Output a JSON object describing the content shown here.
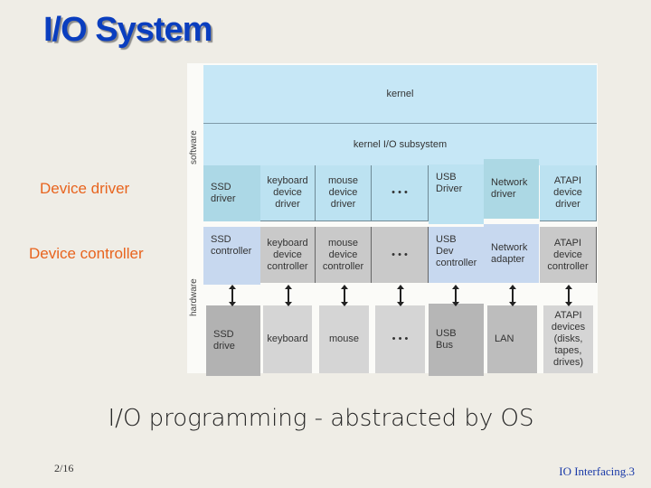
{
  "title": "I/O System",
  "side_labels": {
    "driver": "Device driver",
    "controller": "Device controller"
  },
  "diagram": {
    "software_label": "software",
    "hardware_label": "hardware",
    "kernel": "kernel",
    "kernel_io": "kernel I/O subsystem",
    "drivers": [
      "SSD\ndriver",
      "keyboard\ndevice\ndriver",
      "mouse\ndevice\ndriver",
      "• • •",
      "USB\nDriver",
      "Network\ndriver",
      "ATAPI\ndevice\ndriver"
    ],
    "controllers": [
      "SSD\ncontroller",
      "keyboard\ndevice\ncontroller",
      "mouse\ndevice\ncontroller",
      "• • •",
      "USB\nDev\ncontroller",
      "Network\nadapter",
      "ATAPI\ndevice\ncontroller"
    ],
    "devices": [
      "SSD\ndrive",
      "keyboard",
      "mouse",
      "• • •",
      "USB\nBus",
      "LAN",
      "ATAPI\ndevices\n(disks,\ntapes,\ndrives)"
    ],
    "colors": {
      "kernel": "#c6e7f6",
      "driver": "#bce2f1",
      "controller": "#c9c9c9",
      "added_controller": "#c7d8ef",
      "device": "#d5d5d5"
    }
  },
  "caption": "I/O programming - abstracted by OS",
  "page_number": "2/16",
  "footer": "IO Interfacing.3"
}
